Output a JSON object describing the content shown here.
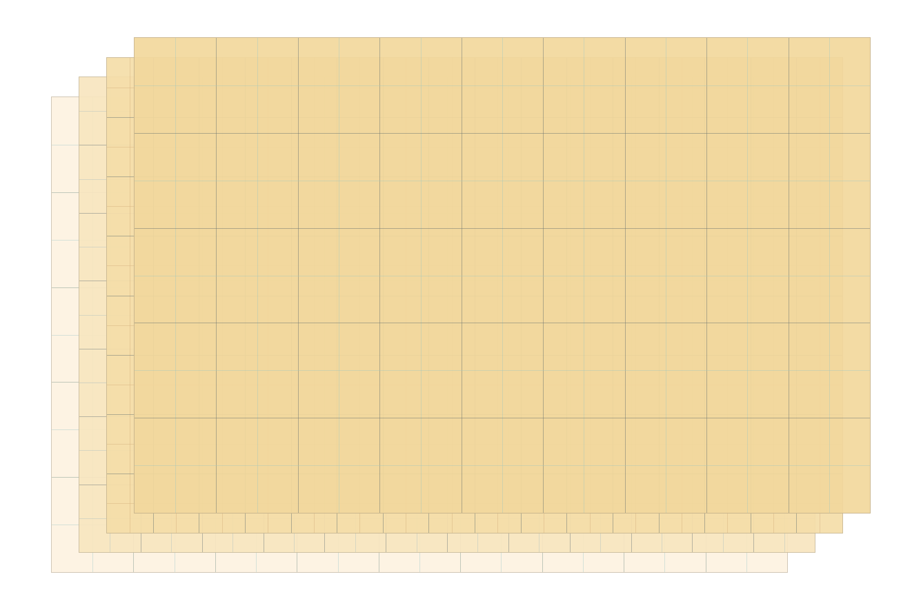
{
  "canvas": {
    "background": "#ffffff"
  },
  "sheets": [
    {
      "name": "sheet-back",
      "fill": "#fdf3e1",
      "minor_color": "rgba(160, 200, 200, 0.45)",
      "major_color": "rgba(110, 140, 130, 0.45)",
      "cols": 9,
      "rows": 5
    },
    {
      "name": "sheet-middle-back",
      "fill": "#f8e6c0",
      "minor_color": "rgba(170, 190, 190, 0.45)",
      "major_color": "rgba(110, 120, 120, 0.5)",
      "cols": 12,
      "rows": 7
    },
    {
      "name": "sheet-middle-front",
      "fill": "#f5dea9",
      "minor_color": "rgba(210, 170, 120, 0.45)",
      "major_color": "rgba(100, 110, 110, 0.5)",
      "cols": 16,
      "rows": 8
    },
    {
      "name": "sheet-front",
      "fill": "#f2d89d",
      "minor_color": "rgba(160, 200, 190, 0.45)",
      "major_color": "rgba(100, 110, 110, 0.5)",
      "cols": 9,
      "rows": 5
    }
  ]
}
